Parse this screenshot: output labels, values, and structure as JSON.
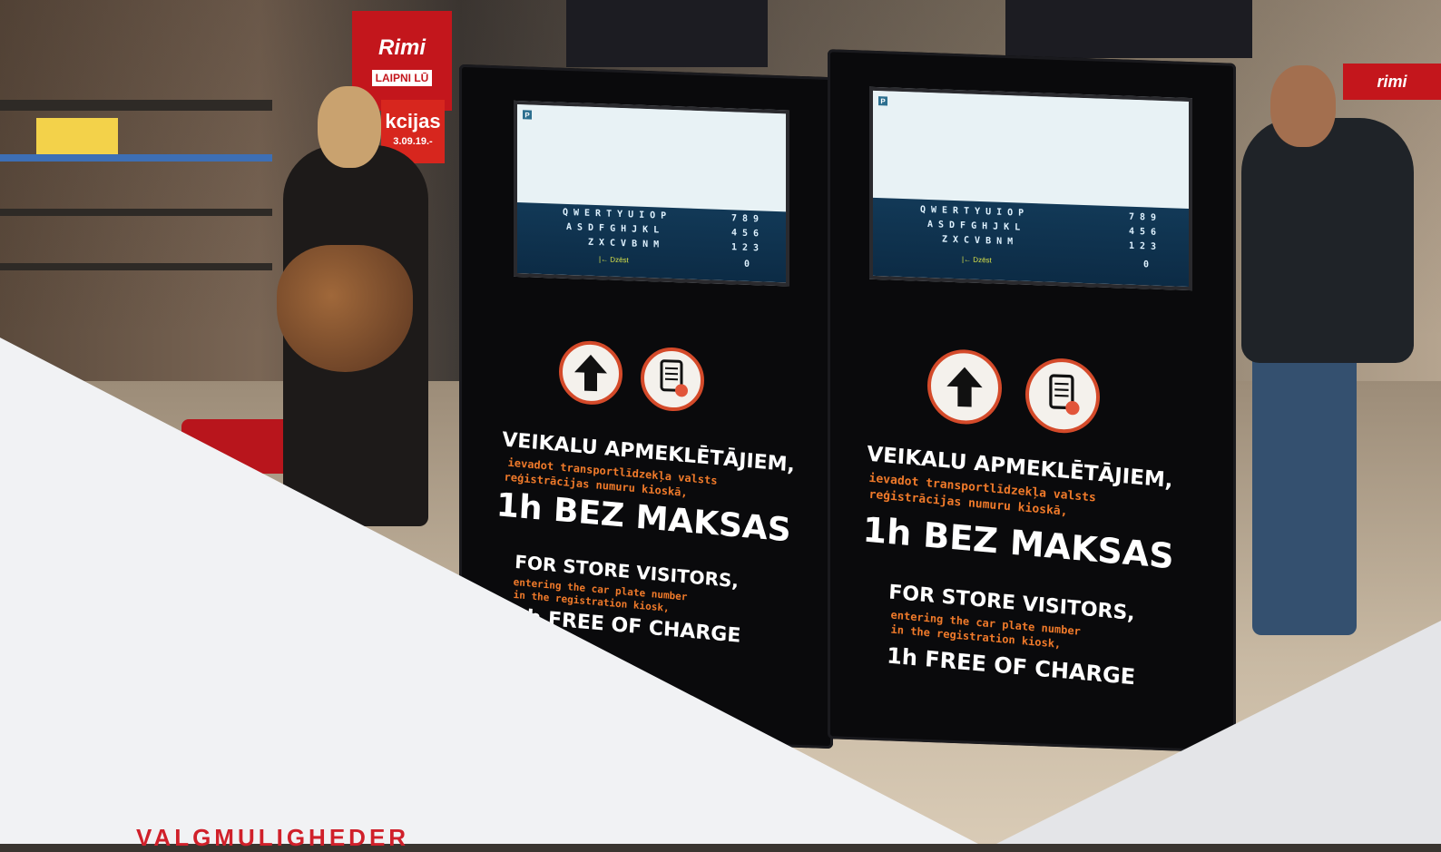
{
  "background_photo": {
    "store_sign_text": "Rimi",
    "store_sign_sub": "LAIPNI LŪ",
    "akcijas_text": "kcijas",
    "akcijas_date": "3.09.19.-",
    "right_sign_text": "rimi"
  },
  "kiosks": [
    {
      "keyboard_rows": [
        "QWERTYUIOP",
        "ASDFGHJKL",
        "ZXCVBNM"
      ],
      "numpad_rows": [
        "789",
        "456",
        "123",
        "0"
      ],
      "delete_label": "|← Dzēst",
      "lv_line1": "VEIKALU APMEKLĒTĀJIEM,",
      "lv_line2": "ievadot transportlīdzekļa valsts",
      "lv_line3": "reģistrācijas numuru kioskā,",
      "lv_line4": "1h BEZ MAKSAS",
      "en_line1": "FOR STORE VISITORS,",
      "en_line2": "entering the car plate number",
      "en_line3": "in the registration kiosk,",
      "en_line4": "1h FREE OF CHARGE"
    },
    {
      "keyboard_rows": [
        "QWERTYUIOP",
        "ASDFGHJKL",
        "ZXCVBNM"
      ],
      "numpad_rows": [
        "789",
        "456",
        "123",
        "0"
      ],
      "delete_label": "|← Dzēst",
      "lv_line1": "VEIKALU APMEKLĒTĀJIEM,",
      "lv_line2": "ievadot transportlīdzekļa valsts",
      "lv_line3": "reģistrācijas numuru kioskā,",
      "lv_line4": "1h BEZ MAKSAS",
      "en_line1": "FOR STORE VISITORS,",
      "en_line2": "entering the car plate number",
      "en_line3": "in the registration kiosk,",
      "en_line4": "1h FREE OF CHARGE"
    }
  ],
  "headline": "VALGMULIGHEDER",
  "colors": {
    "overlay": "#f1f2f4",
    "accent_red": "#d0202a",
    "kiosk_orange": "#f07a2a"
  }
}
